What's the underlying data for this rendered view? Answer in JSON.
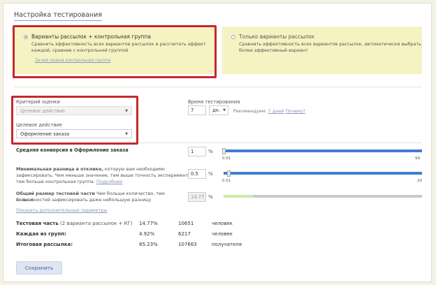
{
  "page": {
    "title": "Настройка тестирования"
  },
  "modes": {
    "left": {
      "title": "Варианты рассылок + контрольная группа",
      "desc_line1": "Сравнить эффективность всех вариантов рассылок и  рассчитать эффект",
      "desc_line2": "каждой, сравнив с  контрольной группой",
      "link": "Зачем нужна контрольная группа"
    },
    "right": {
      "title": "Только варианты рассылок",
      "desc_line1": "Сравнить эффективность всех вариантов рассылок, автоматически выбрать",
      "desc_line2": "более эффективный вариант"
    }
  },
  "criteria": {
    "label": "Критерий оценки",
    "value": "Целевое действие",
    "target_label": "Целевое действие",
    "target_value": "Оформление заказа"
  },
  "time": {
    "label": "Время тестирования",
    "value": "7",
    "unit": "дн.",
    "rec_prefix": "Рекомендуем:",
    "rec_link": "7 дней",
    "rec_why": "Почему?"
  },
  "conversion": {
    "label": "Средняя конверсия в Оформление заказа",
    "value": "1",
    "unit": "%",
    "min": "0.01",
    "max": "99",
    "level_pct": 1
  },
  "min_diff": {
    "label_bold": "Минимальная разница в отклике,",
    "label_rest": " которую вам необходимо",
    "line2": "зафиксировать. Чем меньше значение, тем выше точность эксперимента и",
    "line3_text": "тем больше контрольная группа.",
    "line3_link": "Подробнее",
    "value": "0.5",
    "unit": "%",
    "min": "0.01",
    "max": "20",
    "level_pct": 2.5
  },
  "size": {
    "label_bold": "Общий размер тестовой части",
    "label_rest": " Чем больше количество, тем больше",
    "line2": "возможностей зафиксировать даже небольшую разницу",
    "value": "14.77",
    "unit": "%",
    "level_pct": 14.77
  },
  "more_link": "Показать дополнительные параметры",
  "summary": [
    {
      "label": "Тестовая часть",
      "note": "(2 варианта рассылок + КГ)",
      "pct": "14.77%",
      "count": "10651",
      "unit": "человек"
    },
    {
      "label": "Каждая из групп:",
      "note": "",
      "pct": "4.92%",
      "count": "6217",
      "unit": "человек"
    },
    {
      "label": "Итоговая рассылка:",
      "note": "",
      "pct": "85.23%",
      "count": "107663",
      "unit": "получателя"
    }
  ],
  "save_label": "Сохранить",
  "colors": {
    "highlight": "#c8272f",
    "option_bg": "#f6f3c2",
    "slider": "#3f7fd0",
    "size_fill": "#cfe8a8"
  }
}
